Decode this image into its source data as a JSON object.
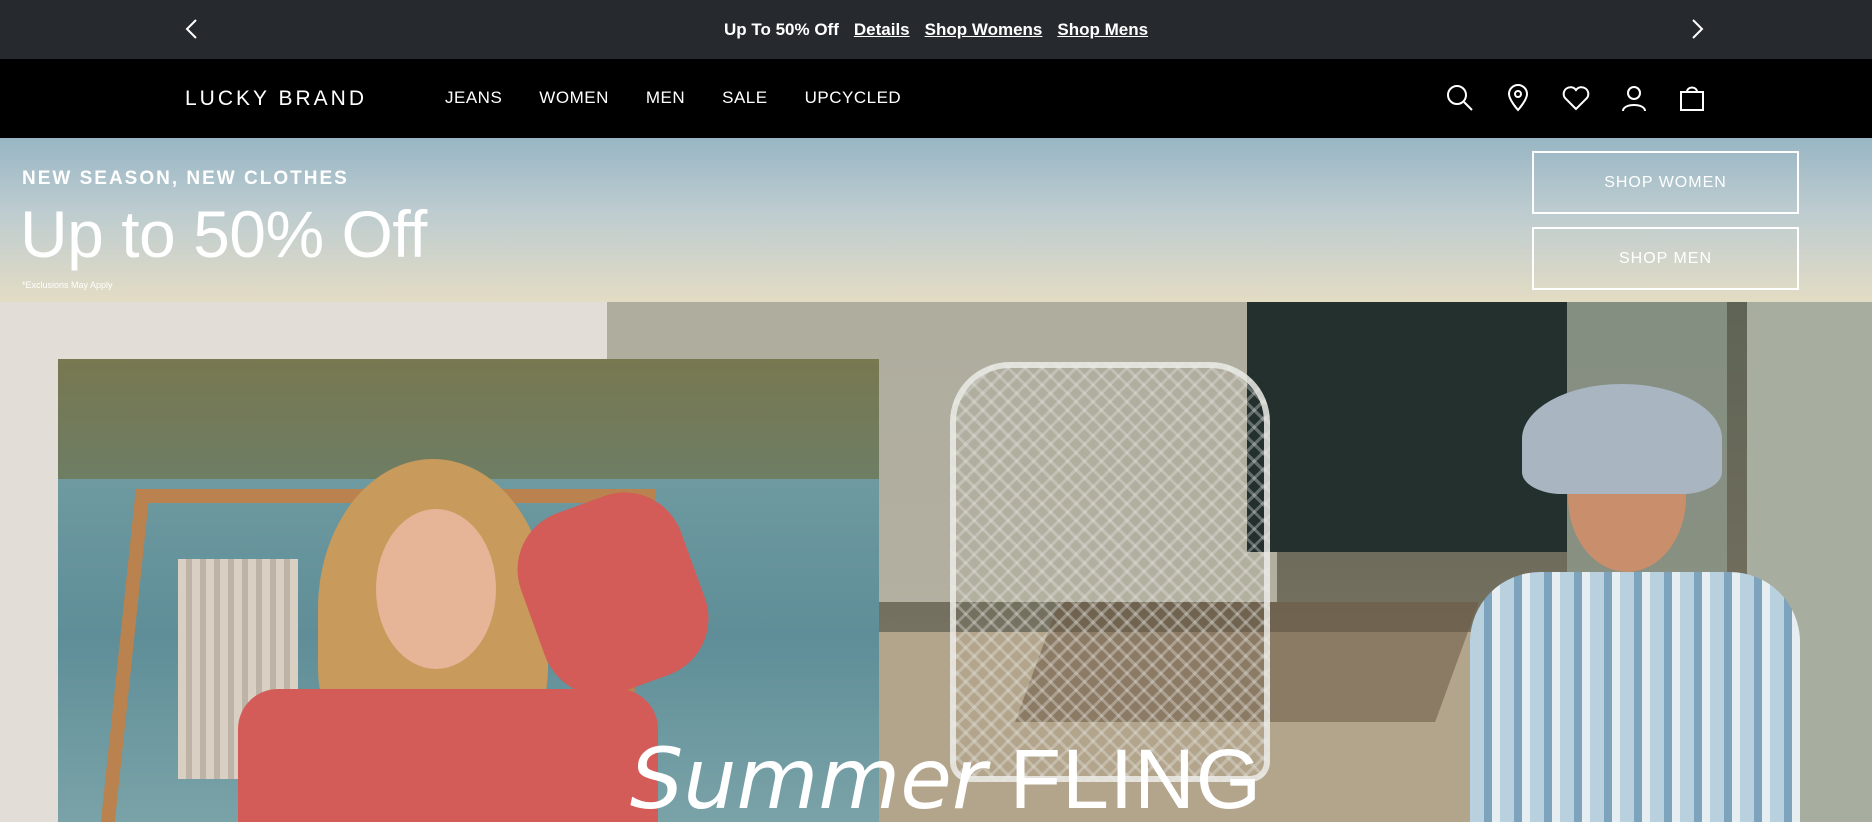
{
  "promo": {
    "text": "Up To 50% Off",
    "links": [
      "Details",
      "Shop Womens",
      "Shop Mens"
    ],
    "prev_icon": "chevron-left-icon",
    "next_icon": "chevron-right-icon"
  },
  "header": {
    "logo": "LUCKY BRAND",
    "nav": [
      "JEANS",
      "WOMEN",
      "MEN",
      "SALE",
      "UPCYCLED"
    ],
    "icons": [
      "search-icon",
      "location-pin-icon",
      "heart-icon",
      "account-icon",
      "shopping-bag-icon"
    ]
  },
  "sale_banner": {
    "kicker": "NEW SEASON, NEW CLOTHES",
    "headline": "Up to 50% Off",
    "fine_print": "*Exclusions May Apply",
    "buttons": [
      "SHOP WOMEN",
      "SHOP MEN"
    ]
  },
  "hero": {
    "title_script": "Summer",
    "title_caps": "FLING"
  },
  "colors": {
    "promo_bg": "#26292d",
    "header_bg": "#000000",
    "text_light": "#ffffff"
  }
}
